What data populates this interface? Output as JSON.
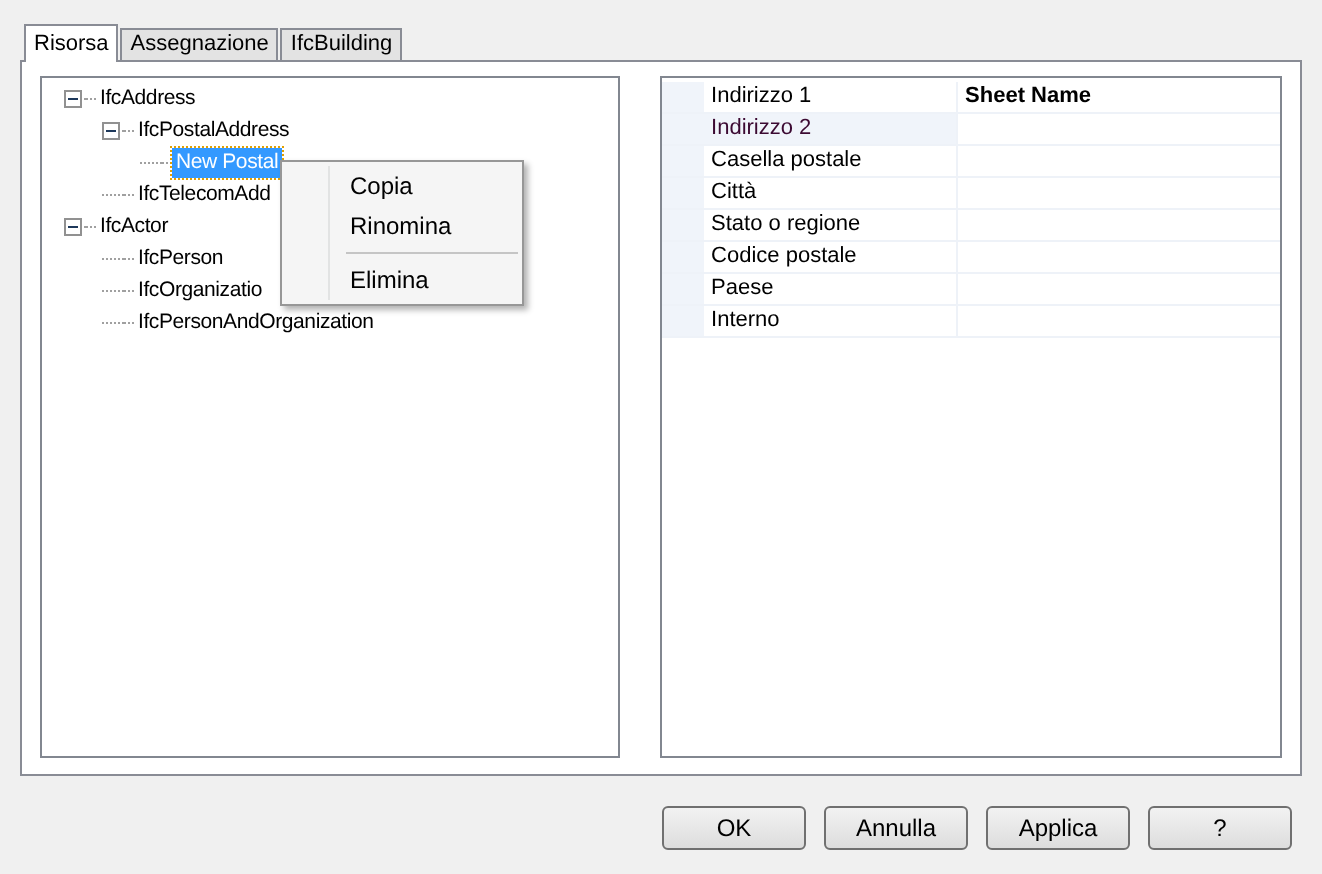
{
  "tabs": [
    {
      "label": "Risorsa",
      "selected": true
    },
    {
      "label": "Assegnazione",
      "selected": false
    },
    {
      "label": "IfcBuilding",
      "selected": false
    }
  ],
  "tree": [
    {
      "label": "IfcAddress",
      "expanded": true,
      "selected": false,
      "children": [
        {
          "label": "IfcPostalAddress",
          "expanded": true,
          "selected": false,
          "children": [
            {
              "label": "New Postal",
              "selected": true
            }
          ]
        },
        {
          "label": "IfcTelecomAdd",
          "selected": false
        }
      ]
    },
    {
      "label": "IfcActor",
      "expanded": true,
      "selected": false,
      "children": [
        {
          "label": "IfcPerson",
          "selected": false
        },
        {
          "label": "IfcOrganizatio",
          "selected": false
        },
        {
          "label": "IfcPersonAndOrganization",
          "selected": false
        }
      ]
    }
  ],
  "context_menu": [
    {
      "kind": "item",
      "label": "Copia"
    },
    {
      "kind": "item",
      "label": "Rinomina"
    },
    {
      "kind": "separator"
    },
    {
      "kind": "item",
      "label": "Elimina"
    }
  ],
  "properties": [
    {
      "name": "Indirizzo 1",
      "value": "Sheet Name",
      "selected": false
    },
    {
      "name": "Indirizzo 2",
      "selected": true
    },
    {
      "name": "Casella postale",
      "selected": false
    },
    {
      "name": "Città",
      "selected": false
    },
    {
      "name": "Stato o regione",
      "selected": false
    },
    {
      "name": "Codice postale",
      "selected": false
    },
    {
      "name": "Paese",
      "selected": false
    },
    {
      "name": "Interno",
      "selected": false
    }
  ],
  "buttons": [
    "OK",
    "Annulla",
    "Applica",
    "?"
  ]
}
